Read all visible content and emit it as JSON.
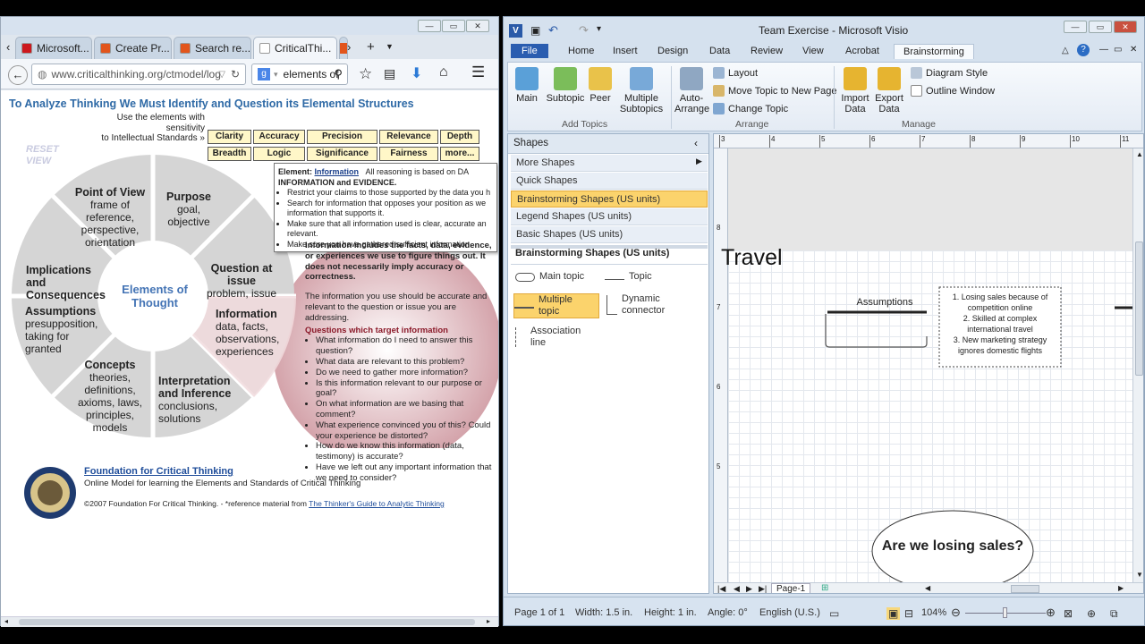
{
  "browser": {
    "tabs": [
      {
        "label": "Microsoft...",
        "icon": "youtube-icon",
        "color": "#cc181e"
      },
      {
        "label": "Create Pr...",
        "icon": "office-icon",
        "color": "#e2551c"
      },
      {
        "label": "Search re...",
        "icon": "office-icon",
        "color": "#e2551c"
      },
      {
        "label": "CriticalThi...",
        "icon": "page-icon",
        "color": "#ffffff"
      }
    ],
    "url": "www.criticalthinking.org/ctmodel/log",
    "search_value": "elements of",
    "page": {
      "heading": "To Analyze Thinking We Must Identify and Question its Elemental Structures",
      "use_elements_text": "Use the elements with",
      "sensitivity_text": "sensitivity",
      "to_standards_text": "to Intellectual Standards »",
      "standards_row1": [
        "Clarity",
        "Accuracy",
        "Precision",
        "Relevance",
        "Depth"
      ],
      "standards_row2": [
        "Breadth",
        "Logic",
        "Significance",
        "Fairness",
        "more..."
      ],
      "reset_view": "RESET VIEW",
      "center_label": "Elements of Thought",
      "elements": [
        {
          "title": "Point of View",
          "sub": "frame of reference, perspective, orientation"
        },
        {
          "title": "Purpose",
          "sub": "goal, objective"
        },
        {
          "title": "Question at issue",
          "sub": "problem, issue"
        },
        {
          "title": "Information",
          "sub": "data, facts, observations, experiences"
        },
        {
          "title": "Interpretation and Inference",
          "sub": "conclusions, solutions"
        },
        {
          "title": "Concepts",
          "sub": "theories, definitions, axioms, laws, principles, models"
        },
        {
          "title": "Assumptions",
          "sub": "presupposition, taking for granted"
        },
        {
          "title": "Implications and Consequences",
          "sub": ""
        }
      ],
      "popup": {
        "prefix": "Element:",
        "name": "Information",
        "intro": "All reasoning is based on DA",
        "intro2": "INFORMATION and EVIDENCE.",
        "bullets": [
          "Restrict your claims to those supported by the data you h",
          "Search for information that opposes your position as we information that supports it.",
          "Make sure that all information used is clear, accurate an relevant.",
          "Make sure you have gathered sufficient information."
        ]
      },
      "info_para1": "Information includes the facts, data, evidence, or experiences we use to figure things out. It does not necessarily imply accuracy or correctness.",
      "info_para2": "The information you use should be accurate and relevant to the question or issue you are addressing.",
      "questions_heading": "Questions which target information",
      "questions": [
        "What information do I need to answer this question?",
        "What data are relevant to this problem?",
        "Do we need to gather more information?",
        "Is this information relevant to our purpose or goal?",
        "On what information are we basing that comment?",
        "What experience convinced you of this? Could your experience be distorted?",
        "How do we know this information (data, testimony) is accurate?",
        "Have we left out any important information that we need to consider?"
      ],
      "foundation_link": "Foundation for Critical Thinking",
      "foundation_sub": "Online Model for learning the Elements and Standards of Critical Thinking",
      "copyright": "©2007 Foundation For Critical Thinking. - *reference material from",
      "guide_link": "The Thinker's Guide to Analytic Thinking",
      "seal_text": "FOUNDATION FOR CRITICAL THINKING"
    }
  },
  "visio": {
    "title": "Team Exercise  -  Microsoft Visio",
    "ribbon_tabs": [
      "File",
      "Home",
      "Insert",
      "Design",
      "Data",
      "Review",
      "View",
      "Acrobat",
      "Brainstorming"
    ],
    "active_tab": "Brainstorming",
    "add_topics": {
      "main": "Main",
      "subtopic": "Subtopic",
      "peer": "Peer",
      "multiple": "Multiple Subtopics",
      "group": "Add Topics"
    },
    "arrange": {
      "auto": "Auto-Arrange",
      "layout": "Layout",
      "move": "Move Topic to New Page",
      "change": "Change Topic",
      "group": "Arrange"
    },
    "manage": {
      "import": "Import Data",
      "export": "Export Data",
      "diagram_style": "Diagram Style",
      "outline": "Outline Window",
      "group": "Manage"
    },
    "shapes_panel": {
      "title": "Shapes",
      "rows": [
        "More Shapes",
        "Quick Shapes",
        "Brainstorming Shapes (US units)",
        "Legend Shapes (US units)",
        "Basic Shapes (US units)"
      ],
      "stencil_title": "Brainstorming Shapes (US units)",
      "stencils": [
        "Main topic",
        "Topic",
        "Multiple topic",
        "Dynamic connector",
        "Association line"
      ]
    },
    "ruler_labels": [
      "3",
      "4",
      "5",
      "6",
      "7",
      "8",
      "9",
      "10",
      "11"
    ],
    "vruler_labels": [
      "8",
      "7",
      "6",
      "5"
    ],
    "canvas": {
      "title_text": "Travel",
      "topic": "Assumptions",
      "list": [
        "1. Losing sales because of competition online",
        "2. Skilled at complex international travel",
        "3. New marketing strategy ignores domestic flights"
      ],
      "main_topic": "Are we losing sales?"
    },
    "page_tab": "Page-1",
    "status": {
      "page": "Page 1 of 1",
      "width": "Width: 1.5 in.",
      "height": "Height: 1 in.",
      "angle": "Angle: 0°",
      "language": "English (U.S.)",
      "zoom": "104%"
    }
  }
}
